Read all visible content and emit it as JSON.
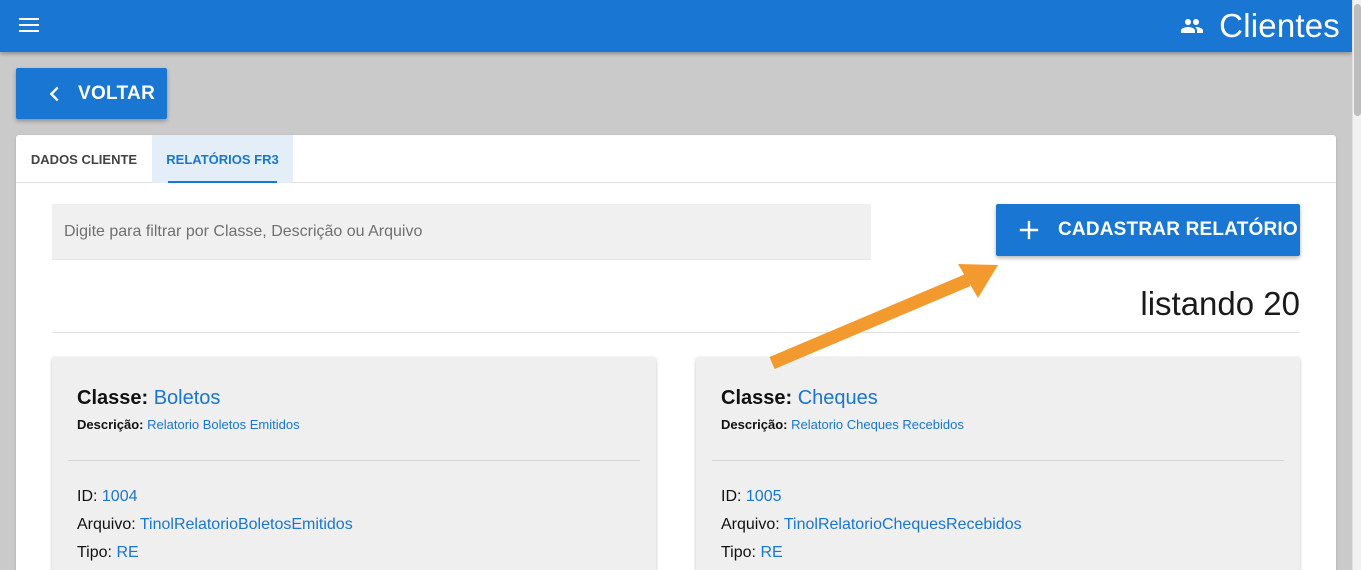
{
  "appbar": {
    "title": "Clientes",
    "menu_icon": "menu-icon",
    "title_icon": "people-icon"
  },
  "back_button": {
    "label": "VOLTAR",
    "icon": "chevron-left-icon"
  },
  "tabs": [
    {
      "label": "DADOS CLIENTE",
      "active": false
    },
    {
      "label": "RELATÓRIOS FR3",
      "active": true
    }
  ],
  "filter": {
    "placeholder": "Digite para filtrar por Classe, Descrição ou Arquivo",
    "value": ""
  },
  "add_button": {
    "label": "CADASTRAR RELATÓRIO",
    "icon": "plus-icon"
  },
  "listing": {
    "count_text": "listando 20"
  },
  "labels": {
    "classe": "Classe:",
    "descricao": "Descrição:",
    "id": "ID:",
    "arquivo": "Arquivo:",
    "tipo": "Tipo:"
  },
  "reports": [
    {
      "classe": "Boletos",
      "descricao": "Relatorio Boletos Emitidos",
      "id": "1004",
      "arquivo": "TinolRelatorioBoletosEmitidos",
      "tipo": "RE"
    },
    {
      "classe": "Cheques",
      "descricao": "Relatorio Cheques Recebidos",
      "id": "1005",
      "arquivo": "TinolRelatorioChequesRecebidos",
      "tipo": "RE"
    }
  ],
  "colors": {
    "primary": "#1976d2",
    "annotation_arrow": "#f39a2e",
    "background": "#cacaca"
  }
}
